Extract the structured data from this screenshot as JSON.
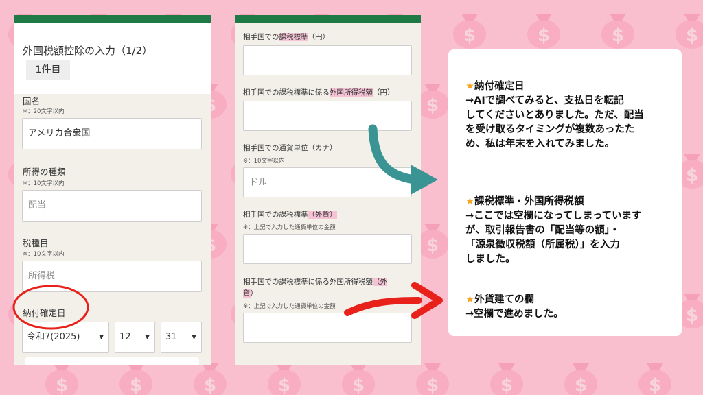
{
  "colors": {
    "accent": "#1f7a45",
    "background": "#f9bfcf",
    "teal_arrow": "#3b9494",
    "red_marker": "#e8211b",
    "star": "#f5a623"
  },
  "left_form": {
    "title": "外国税額控除の入力（1/2）",
    "count_chip": "1件目",
    "country": {
      "label": "国名",
      "note": "※：20文字以内",
      "value": "アメリカ合衆国"
    },
    "income_type": {
      "label": "所得の種類",
      "note": "※：10文字以内",
      "value": "配当"
    },
    "tax_item": {
      "label": "税種目",
      "note": "※：10文字以内",
      "value": "所得税"
    },
    "payment_date": {
      "label": "納付確定日",
      "era_year": "令和7(2025)",
      "month": "12",
      "day": "31"
    }
  },
  "mid_form": {
    "field1_label": {
      "pre": "相手国での",
      "hl": "課税標準",
      "post": "（円）"
    },
    "field2_label": {
      "pre": "相手国での課税標準に係る",
      "hl": "外国所得税額",
      "post": "（円）"
    },
    "field3": {
      "label": "相手国での通貨単位（カナ）",
      "note": "※：10文字以内",
      "value": "ドル"
    },
    "field4_label": {
      "pre": "相手国での課税標準",
      "hl": "（外貨）"
    },
    "field4_note": "※：上記で入力した通貨単位の金額",
    "field5_label": {
      "pre": "相手国での課税標準に係る外国所得税額",
      "hl1": "（外",
      "hl2": "貨",
      "post": "）"
    },
    "field5_note": "※：上記で入力した通貨単位の金額"
  },
  "info": {
    "star": "★",
    "block1": {
      "heading": "納付確定日",
      "lines": [
        "→AIで調べてみると、支払日を転記",
        "してくださいとありました。ただ、配当",
        "を受け取るタイミングが複数あったた",
        "め、私は年末を入れてみました。"
      ]
    },
    "block2": {
      "heading": "課税標準・外国所得税額",
      "lines": [
        "→ここでは空欄になってしまっています",
        "が、取引報告書の「配当等の額」・",
        "「源泉徴収税額（所属税）」を入力",
        "しました。"
      ]
    },
    "block3": {
      "heading": "外貨建ての欄",
      "lines": [
        "→空欄で進めました。"
      ]
    }
  }
}
